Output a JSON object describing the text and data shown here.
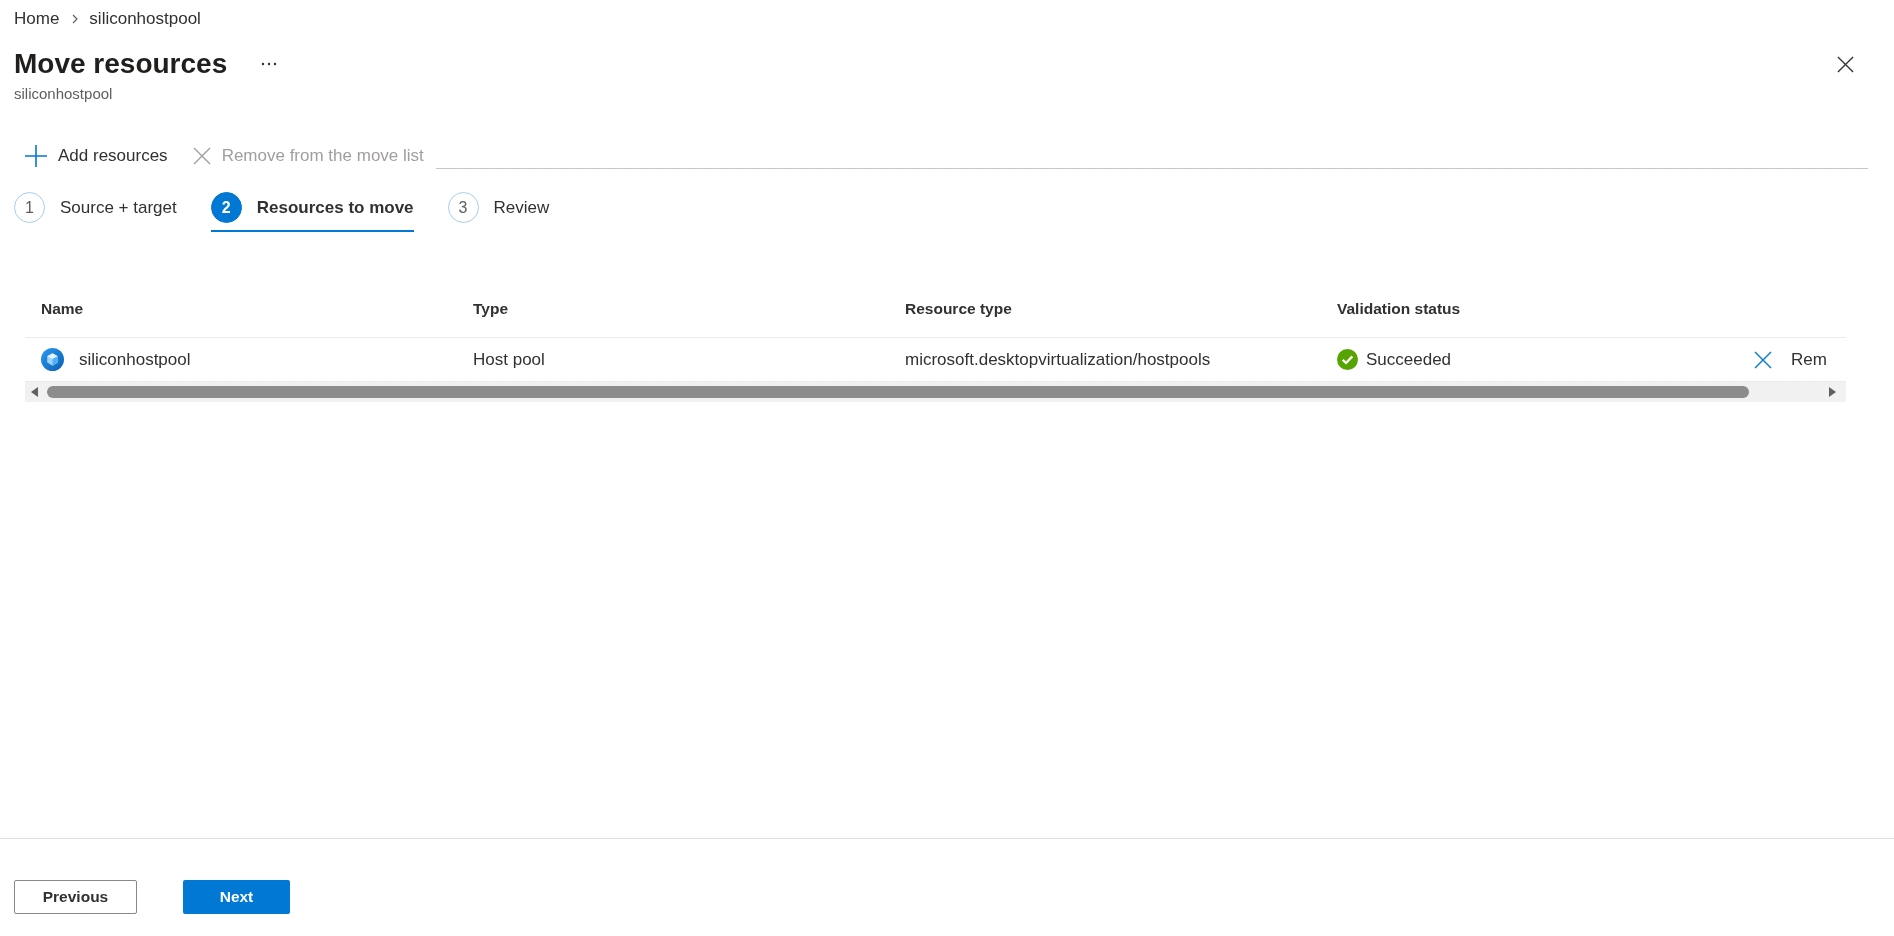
{
  "breadcrumb": [
    {
      "label": "Home"
    },
    {
      "label": "siliconhostpool"
    }
  ],
  "header": {
    "title": "Move resources",
    "subtitle": "siliconhostpool"
  },
  "toolbar": [
    {
      "kind": "add",
      "label": "Add resources",
      "disabled": false
    },
    {
      "kind": "remove",
      "label": "Remove from the move list",
      "disabled": true
    }
  ],
  "steps": [
    {
      "number": "1",
      "label": "Source + target",
      "selected": false
    },
    {
      "number": "2",
      "label": "Resources to move",
      "selected": true
    },
    {
      "number": "3",
      "label": "Review",
      "selected": false
    }
  ],
  "table": {
    "columns": [
      "Name",
      "Type",
      "Resource type",
      "Validation status"
    ],
    "rows": [
      {
        "name": "siliconhostpool",
        "type": "Host pool",
        "resource_type": "microsoft.desktopvirtualization/hostpools",
        "validation_status": "Succeeded",
        "action": "Rem"
      }
    ]
  },
  "footer": {
    "buttons": [
      {
        "kind": "previous",
        "label": "Previous"
      },
      {
        "kind": "next",
        "label": "Next"
      }
    ]
  }
}
